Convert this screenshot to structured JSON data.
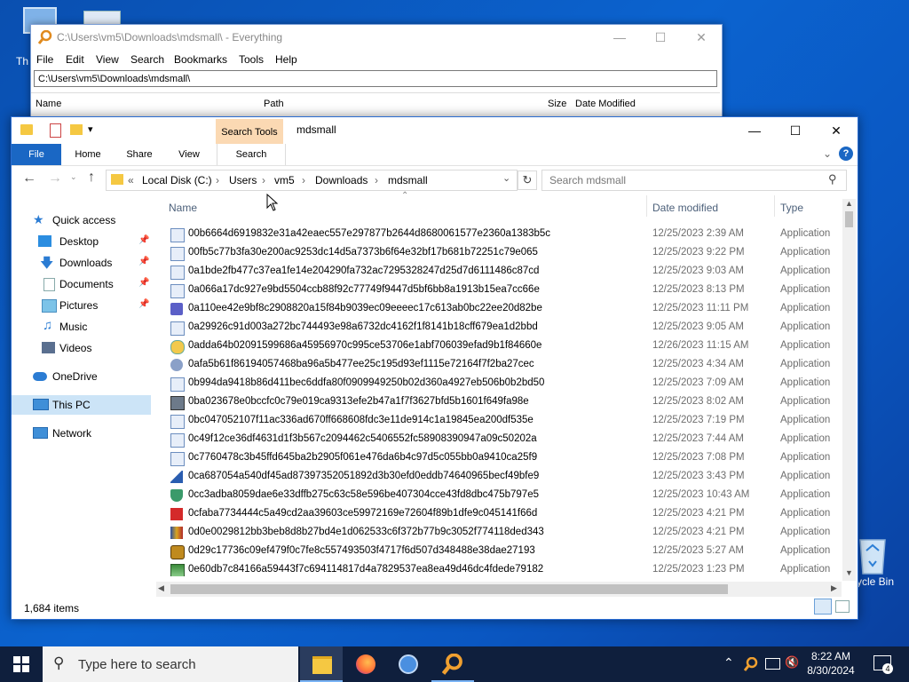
{
  "desktop": {
    "icon_this_pc_partial": "Th",
    "recycle_bin_label": "ycle Bin"
  },
  "everything": {
    "title": "C:\\Users\\vm5\\Downloads\\mdsmall\\ - Everything",
    "menu": [
      "File",
      "Edit",
      "View",
      "Search",
      "Bookmarks",
      "Tools",
      "Help"
    ],
    "search_value": "C:\\Users\\vm5\\Downloads\\mdsmall\\",
    "columns": [
      "Name",
      "Path",
      "Size",
      "Date Modified"
    ]
  },
  "explorer": {
    "title": "mdsmall",
    "ribbon": {
      "contextual_group": "Search Tools",
      "tabs": [
        "File",
        "Home",
        "Share",
        "View",
        "Search"
      ]
    },
    "address": {
      "crumbs": [
        "«",
        "Local Disk (C:)",
        "›",
        "Users",
        "›",
        "vm5",
        "›",
        "Downloads",
        "›",
        "mdsmall"
      ]
    },
    "search_placeholder": "Search mdsmall",
    "nav": [
      {
        "label": "Quick access",
        "pinned": false
      },
      {
        "label": "Desktop",
        "pinned": true
      },
      {
        "label": "Downloads",
        "pinned": true
      },
      {
        "label": "Documents",
        "pinned": true
      },
      {
        "label": "Pictures",
        "pinned": true
      },
      {
        "label": "Music",
        "pinned": false
      },
      {
        "label": "Videos",
        "pinned": false
      },
      {
        "label": "OneDrive",
        "pinned": false
      },
      {
        "label": "This PC",
        "pinned": false
      },
      {
        "label": "Network",
        "pinned": false
      }
    ],
    "columns": {
      "name": "Name",
      "date": "Date modified",
      "type": "Type"
    },
    "files": [
      {
        "name": "00b6664d6919832e31a42eaec557e297877b2644d8680061577e2360a1383b5c",
        "date": "12/25/2023 2:39 AM",
        "type": "Application"
      },
      {
        "name": "00fb5c77b3fa30e200ac9253dc14d5a7373b6f64e32bf17b681b72251c79e065",
        "date": "12/25/2023 9:22 PM",
        "type": "Application"
      },
      {
        "name": "0a1bde2fb477c37ea1fe14e204290fa732ac7295328247d25d7d6111486c87cd",
        "date": "12/25/2023 9:03 AM",
        "type": "Application"
      },
      {
        "name": "0a066a17dc927e9bd5504ccb88f92c77749f9447d5bf6bb8a1913b15ea7cc66e",
        "date": "12/25/2023 8:13 PM",
        "type": "Application"
      },
      {
        "name": "0a110ee42e9bf8c2908820a15f84b9039ec09eeeec17c613ab0bc22ee20d82be",
        "date": "12/25/2023 11:11 PM",
        "type": "Application"
      },
      {
        "name": "0a29926c91d003a272bc744493e98a6732dc4162f1f8141b18cff679ea1d2bbd",
        "date": "12/25/2023 9:05 AM",
        "type": "Application"
      },
      {
        "name": "0adda64b02091599686a45956970c995ce53706e1abf706039efad9b1f84660e",
        "date": "12/26/2023 11:15 AM",
        "type": "Application"
      },
      {
        "name": "0afa5b61f86194057468ba96a5b477ee25c195d93ef1115e72164f7f2ba27cec",
        "date": "12/25/2023 4:34 AM",
        "type": "Application"
      },
      {
        "name": "0b994da9418b86d411bec6ddfa80f0909949250b02d360a4927eb506b0b2bd50",
        "date": "12/25/2023 7:09 AM",
        "type": "Application"
      },
      {
        "name": "0ba023678e0bccfc0c79e019ca9313efe2b47a1f7f3627bfd5b1601f649fa98e",
        "date": "12/25/2023 8:02 AM",
        "type": "Application"
      },
      {
        "name": "0bc047052107f11ac336ad670ff668608fdc3e11de914c1a19845ea200df535e",
        "date": "12/25/2023 7:19 PM",
        "type": "Application"
      },
      {
        "name": "0c49f12ce36df4631d1f3b567c2094462c5406552fc58908390947a09c50202a",
        "date": "12/25/2023 7:44 AM",
        "type": "Application"
      },
      {
        "name": "0c7760478c3b45ffd645ba2b2905f061e476da6b4c97d5c055bb0a9410ca25f9",
        "date": "12/25/2023 7:08 PM",
        "type": "Application"
      },
      {
        "name": "0ca687054a540df45ad87397352051892d3b30efd0eddb74640965becf49bfe9",
        "date": "12/25/2023 3:43 PM",
        "type": "Application"
      },
      {
        "name": "0cc3adba8059dae6e33dffb275c63c58e596be407304cce43fd8dbc475b797e5",
        "date": "12/25/2023 10:43 AM",
        "type": "Application"
      },
      {
        "name": "0cfaba7734444c5a49cd2aa39603ce59972169e72604f89b1dfe9c045141f66d",
        "date": "12/25/2023 4:21 PM",
        "type": "Application"
      },
      {
        "name": "0d0e0029812bb3beb8d8b27bd4e1d062533c6f372b77b9c3052f774118ded343",
        "date": "12/25/2023 4:21 PM",
        "type": "Application"
      },
      {
        "name": "0d29c17736c09ef479f0c7fe8c557493503f4717f6d507d348488e38dae27193",
        "date": "12/25/2023 5:27 AM",
        "type": "Application"
      },
      {
        "name": "0e60db7c84166a59443f7c694114817d4a7829537ea8ea49d46dc4fdede79182",
        "date": "12/25/2023 1:23 PM",
        "type": "Application"
      }
    ],
    "status": "1,684 items"
  },
  "taskbar": {
    "search_placeholder": "Type here to search",
    "time": "8:22 AM",
    "date": "8/30/2024",
    "notification_count": "4"
  }
}
